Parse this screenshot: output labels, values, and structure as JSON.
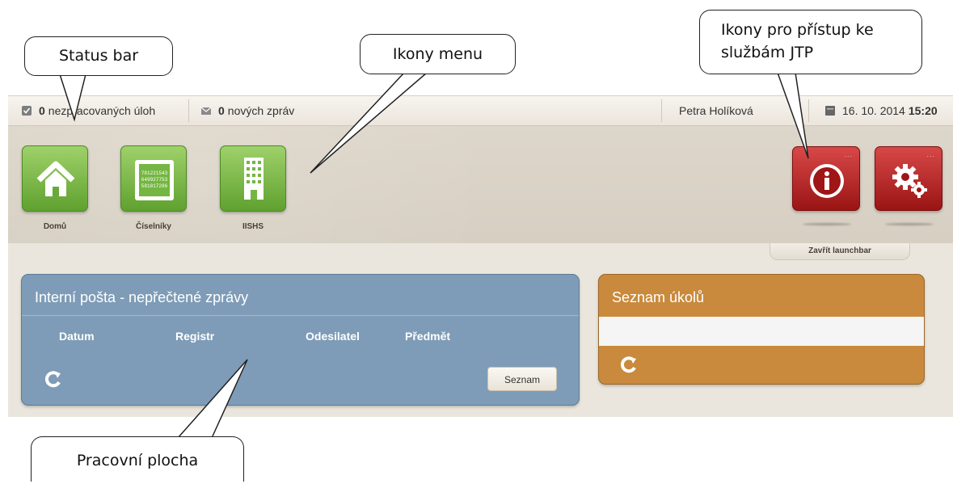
{
  "status_bar": {
    "tasks_count": "0",
    "tasks_label": "nezpracovaných úloh",
    "messages_count": "0",
    "messages_label": "nových zpráv",
    "user_name": "Petra Holíková",
    "date": "16. 10. 2014",
    "time": "15:20"
  },
  "launchbar": {
    "menu_tiles": [
      {
        "label": "Domů",
        "icon": "home-icon",
        "color": "#6fb43b"
      },
      {
        "label": "Číselníky",
        "icon": "codelist-icon",
        "color": "#6fb43b",
        "icon_text": [
          "781221543",
          "649927753",
          "581017286"
        ]
      },
      {
        "label": "IISHS",
        "icon": "building-icon",
        "color": "#6fb43b"
      }
    ],
    "service_tiles": [
      {
        "icon": "info-icon",
        "color": "#b52020",
        "dots": "..."
      },
      {
        "icon": "gears-icon",
        "color": "#b52020",
        "dots": "..."
      }
    ],
    "close_label": "Zavřít launchbar"
  },
  "desktop": {
    "mail_widget": {
      "title": "Interní pošta - nepřečtené zprávy",
      "columns": [
        "Datum",
        "Registr",
        "Odesilatel",
        "Předmět"
      ],
      "button_label": "Seznam",
      "color": "#7e9cb7"
    },
    "tasks_widget": {
      "title": "Seznam úkolů",
      "color": "#c98a3d"
    }
  },
  "callouts": {
    "status_bar": "Status bar",
    "menu_icons": "Ikony menu",
    "jtp_services": [
      "Ikony pro přístup ke",
      "službám JTP"
    ],
    "workspace": "Pracovní plocha"
  }
}
